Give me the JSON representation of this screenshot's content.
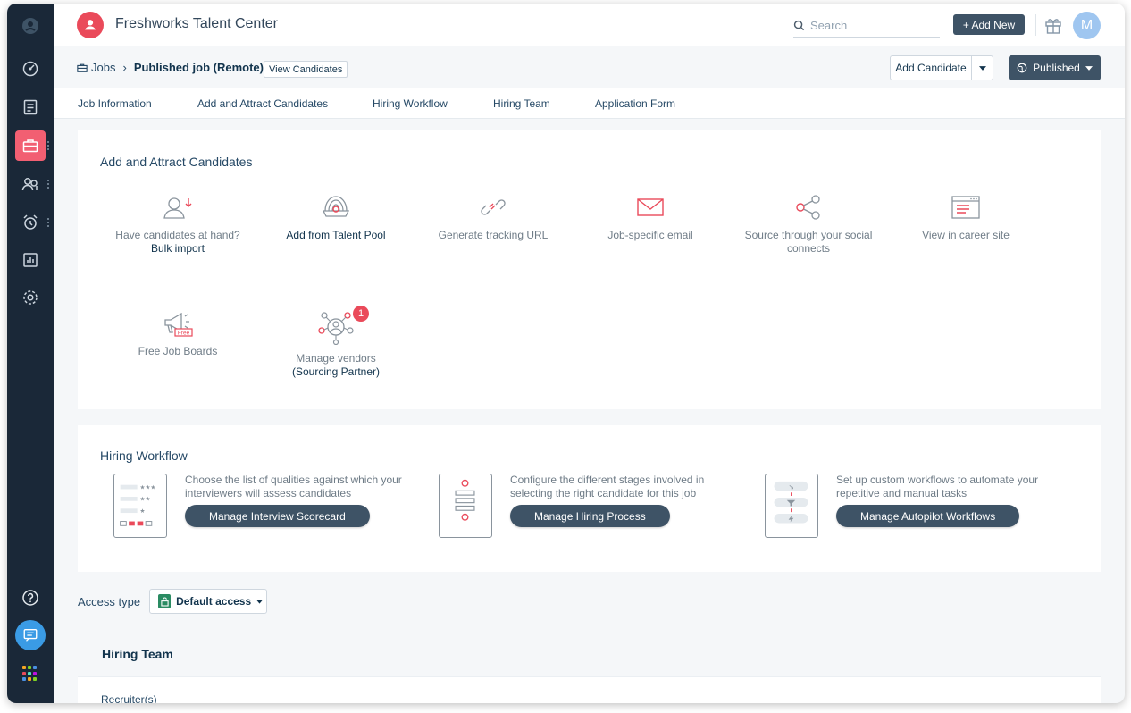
{
  "app": {
    "title": "Freshworks Talent Center"
  },
  "sidebar": {
    "items": [
      {
        "icon": "dashboard-icon"
      },
      {
        "icon": "notes-icon"
      },
      {
        "icon": "briefcase-icon"
      },
      {
        "icon": "candidates-icon"
      },
      {
        "icon": "alarm-icon"
      },
      {
        "icon": "reports-icon"
      },
      {
        "icon": "settings-icon"
      }
    ],
    "help_icon": "help-icon",
    "chat_icon": "chat-icon",
    "apps_icon": "apps-grid-icon"
  },
  "topbar": {
    "search_placeholder": "Search",
    "add_new_label": "+ Add New",
    "avatar_initial": "M"
  },
  "breadcrumb": {
    "root": "Jobs",
    "current": "Published job (Remote)",
    "view_candidates": "View Candidates"
  },
  "actions": {
    "add_candidate": "Add Candidate",
    "published": "Published"
  },
  "tabs": [
    "Job Information",
    "Add and Attract Candidates",
    "Hiring Workflow",
    "Hiring Team",
    "Application Form"
  ],
  "attract": {
    "title": "Add and Attract Candidates",
    "options": [
      {
        "line1": "Have candidates at hand?",
        "line2": "Bulk import"
      },
      {
        "line1": "Add from Talent Pool",
        "line2": ""
      },
      {
        "line1": "Generate tracking URL",
        "line2": ""
      },
      {
        "line1": "Job-specific email",
        "line2": ""
      },
      {
        "line1": "Source through your social",
        "line2": "connects"
      },
      {
        "line1": "View in career site",
        "line2": ""
      },
      {
        "line1": "Free Job Boards",
        "line2": ""
      },
      {
        "line1": "Manage vendors",
        "line2": "(Sourcing Partner)"
      }
    ],
    "free_tag": "Free",
    "vendor_badge": "1"
  },
  "workflow": {
    "title": "Hiring Workflow",
    "items": [
      {
        "desc": "Choose the list of qualities against which your interviewers will assess candidates",
        "button": "Manage Interview Scorecard"
      },
      {
        "desc": "Configure the different stages involved in selecting the right candidate for this job",
        "button": "Manage Hiring Process"
      },
      {
        "desc": "Set up custom workflows to automate your repetitive and manual tasks",
        "button": "Manage Autopilot Workflows"
      }
    ]
  },
  "access": {
    "label": "Access type",
    "value": "Default access"
  },
  "hiring_team": {
    "title": "Hiring Team",
    "recruiters_label": "Recruiter(s)"
  },
  "colors": {
    "sidebar_bg": "#1a2838",
    "accent": "#ea4a5a",
    "primary_button": "#3e5366",
    "chat_button": "#3a9be5"
  }
}
